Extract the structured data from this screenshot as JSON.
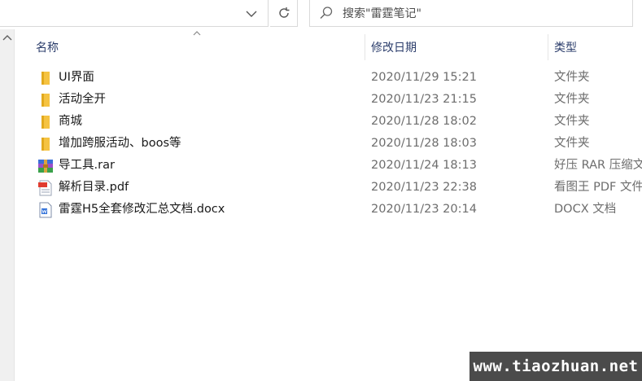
{
  "search": {
    "placeholder": "搜索\"雷霆笔记\""
  },
  "columns": {
    "name": "名称",
    "date": "修改日期",
    "type": "类型"
  },
  "files": [
    {
      "name": "UI界面",
      "date": "2020/11/29 15:21",
      "type": "文件夹",
      "icon": "folder-icon"
    },
    {
      "name": "活动全开",
      "date": "2020/11/23 21:15",
      "type": "文件夹",
      "icon": "folder-icon"
    },
    {
      "name": "商城",
      "date": "2020/11/28 18:02",
      "type": "文件夹",
      "icon": "folder-icon"
    },
    {
      "name": "增加跨服活动、boos等",
      "date": "2020/11/28 18:03",
      "type": "文件夹",
      "icon": "folder-icon"
    },
    {
      "name": "导工具.rar",
      "date": "2020/11/24 18:13",
      "type": "好压 RAR 压缩文件",
      "icon": "rar-archive-icon"
    },
    {
      "name": "解析目录.pdf",
      "date": "2020/11/23 22:38",
      "type": "看图王 PDF 文件",
      "icon": "pdf-file-icon"
    },
    {
      "name": "雷霆H5全套修改汇总文档.docx",
      "date": "2020/11/23 20:14",
      "type": "DOCX 文档",
      "icon": "docx-file-icon"
    }
  ],
  "watermark": {
    "text": "www.tiaozhuan.net"
  },
  "colors": {
    "folder": "#f5c342",
    "header_text": "#2b3d6b",
    "watermark_bg": "#4b4b4b"
  }
}
